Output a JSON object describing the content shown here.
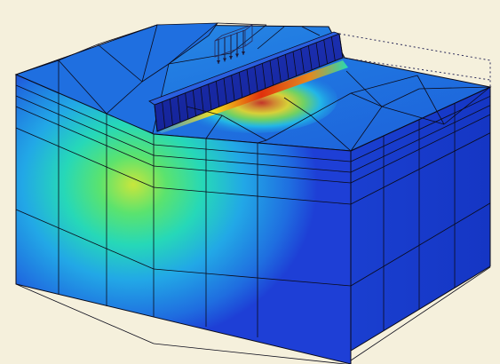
{
  "viewport": {
    "background": "#f5f0dc",
    "model_label": ""
  },
  "model": {
    "kind": "fem-soil-block-with-footing-strip",
    "contour_colormap": [
      "#1e3fd6",
      "#1f7fe3",
      "#22c3e8",
      "#26e0b0",
      "#5be36e",
      "#c8e63c",
      "#f7e21b",
      "#f08a14",
      "#e02a0a"
    ],
    "mesh_line_color": "#0b0b1a",
    "outline_style": "dotted",
    "outline_color": "#2b2b5a",
    "load_arrows_count": 5
  }
}
